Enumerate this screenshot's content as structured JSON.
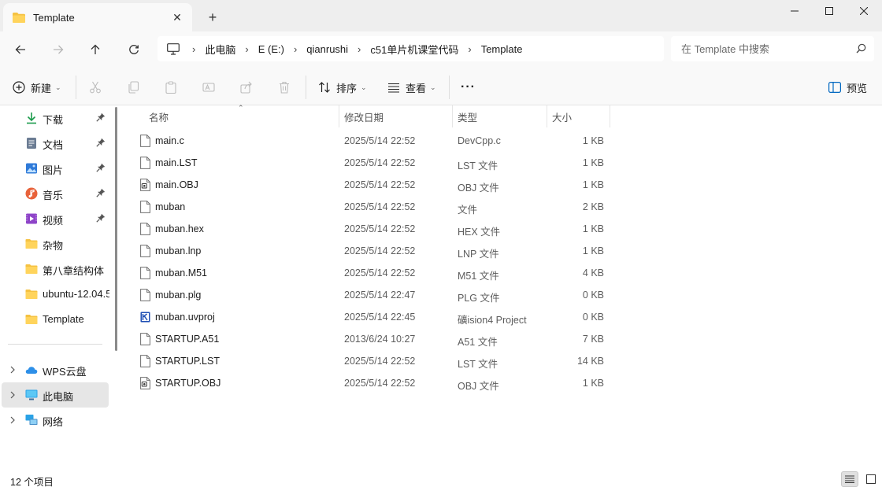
{
  "tab": {
    "title": "Template",
    "close": "✕",
    "new_tab": "+"
  },
  "navigation": {
    "breadcrumbs": [
      "此电脑",
      "E (E:)",
      "qianrushi",
      "c51单片机课堂代码",
      "Template"
    ],
    "search_placeholder": "在 Template 中搜索"
  },
  "toolbar": {
    "new_label": "新建",
    "sort_label": "排序",
    "view_label": "查看",
    "more": "···",
    "preview_label": "预览"
  },
  "sidebar": {
    "quick_access": [
      {
        "label": "下载",
        "icon": "download-icon",
        "pinned": true
      },
      {
        "label": "文档",
        "icon": "document-icon",
        "pinned": true
      },
      {
        "label": "图片",
        "icon": "pictures-icon",
        "pinned": true
      },
      {
        "label": "音乐",
        "icon": "music-icon",
        "pinned": true
      },
      {
        "label": "视频",
        "icon": "video-icon",
        "pinned": true
      },
      {
        "label": "杂物",
        "icon": "folder-icon",
        "pinned": false
      },
      {
        "label": "第八章结构体",
        "icon": "folder-icon",
        "pinned": false
      },
      {
        "label": "ubuntu-12.04.5",
        "icon": "folder-icon",
        "pinned": false
      },
      {
        "label": "Template",
        "icon": "folder-icon",
        "pinned": false
      }
    ],
    "locations": [
      {
        "label": "WPS云盘",
        "icon": "cloud-icon",
        "selected": false
      },
      {
        "label": "此电脑",
        "icon": "computer-icon",
        "selected": true
      },
      {
        "label": "网络",
        "icon": "network-icon",
        "selected": false
      }
    ]
  },
  "columns": [
    "名称",
    "修改日期",
    "类型",
    "大小"
  ],
  "files": [
    {
      "name": "main.c",
      "date": "2025/5/14 22:52",
      "type": "DevCpp.c",
      "size": "1 KB",
      "icon": "file-icon"
    },
    {
      "name": "main.LST",
      "date": "2025/5/14 22:52",
      "type": "LST 文件",
      "size": "1 KB",
      "icon": "file-icon"
    },
    {
      "name": "main.OBJ",
      "date": "2025/5/14 22:52",
      "type": "OBJ 文件",
      "size": "1 KB",
      "icon": "obj-file-icon"
    },
    {
      "name": "muban",
      "date": "2025/5/14 22:52",
      "type": "文件",
      "size": "2 KB",
      "icon": "file-icon"
    },
    {
      "name": "muban.hex",
      "date": "2025/5/14 22:52",
      "type": "HEX 文件",
      "size": "1 KB",
      "icon": "file-icon"
    },
    {
      "name": "muban.lnp",
      "date": "2025/5/14 22:52",
      "type": "LNP 文件",
      "size": "1 KB",
      "icon": "file-icon"
    },
    {
      "name": "muban.M51",
      "date": "2025/5/14 22:52",
      "type": "M51 文件",
      "size": "4 KB",
      "icon": "file-icon"
    },
    {
      "name": "muban.plg",
      "date": "2025/5/14 22:47",
      "type": "PLG 文件",
      "size": "0 KB",
      "icon": "file-icon"
    },
    {
      "name": "muban.uvproj",
      "date": "2025/5/14 22:45",
      "type": "礦ision4 Project",
      "size": "0 KB",
      "icon": "keil-project-icon"
    },
    {
      "name": "STARTUP.A51",
      "date": "2013/6/24 10:27",
      "type": "A51 文件",
      "size": "7 KB",
      "icon": "file-icon"
    },
    {
      "name": "STARTUP.LST",
      "date": "2025/5/14 22:52",
      "type": "LST 文件",
      "size": "14 KB",
      "icon": "file-icon"
    },
    {
      "name": "STARTUP.OBJ",
      "date": "2025/5/14 22:52",
      "type": "OBJ 文件",
      "size": "1 KB",
      "icon": "obj-file-icon"
    }
  ],
  "status": {
    "item_count": "12 个项目"
  },
  "colors": {
    "folder": "#f5c242",
    "accent": "#0067c0",
    "selected_bg": "#e6e6e6"
  }
}
